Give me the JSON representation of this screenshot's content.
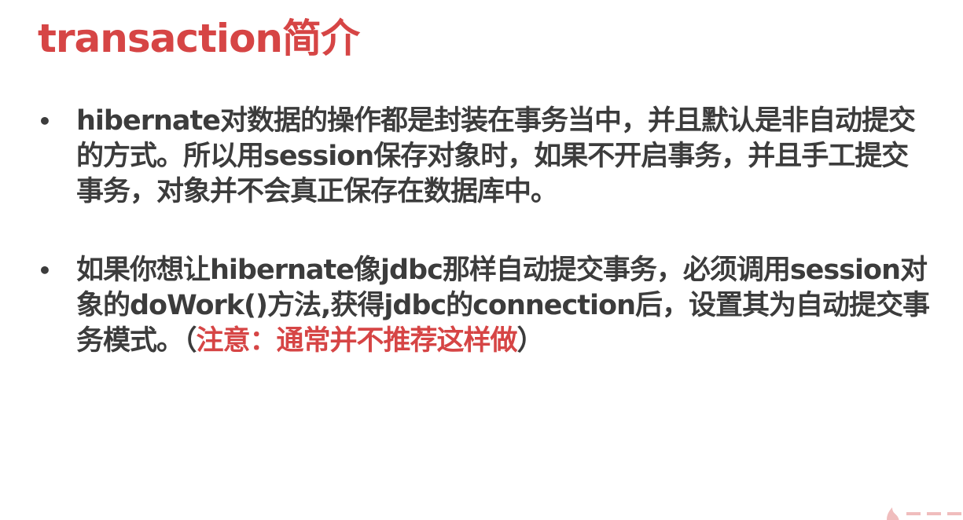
{
  "slide": {
    "title": "transaction简介",
    "bullets": [
      {
        "marker": "•",
        "text": "hibernate对数据的操作都是封装在事务当中，并且默认是非自动提交的方式。所以用session保存对象时，如果不开启事务，并且手工提交事务，对象并不会真正保存在数据库中。"
      },
      {
        "marker": "•",
        "text": "如果你想让hibernate像jdbc那样自动提交事务，必须调用session对象的doWork()方法,获得jdbc的connection后，设置其为自动提交事务模式。（",
        "highlight": "注意：通常并不推荐这样做",
        "suffix": "）"
      }
    ]
  },
  "colors": {
    "accent": "#d64545",
    "body_text": "#3c3c3c",
    "background": "#ffffff"
  },
  "watermark": {
    "icon": "flame-logo-icon"
  }
}
